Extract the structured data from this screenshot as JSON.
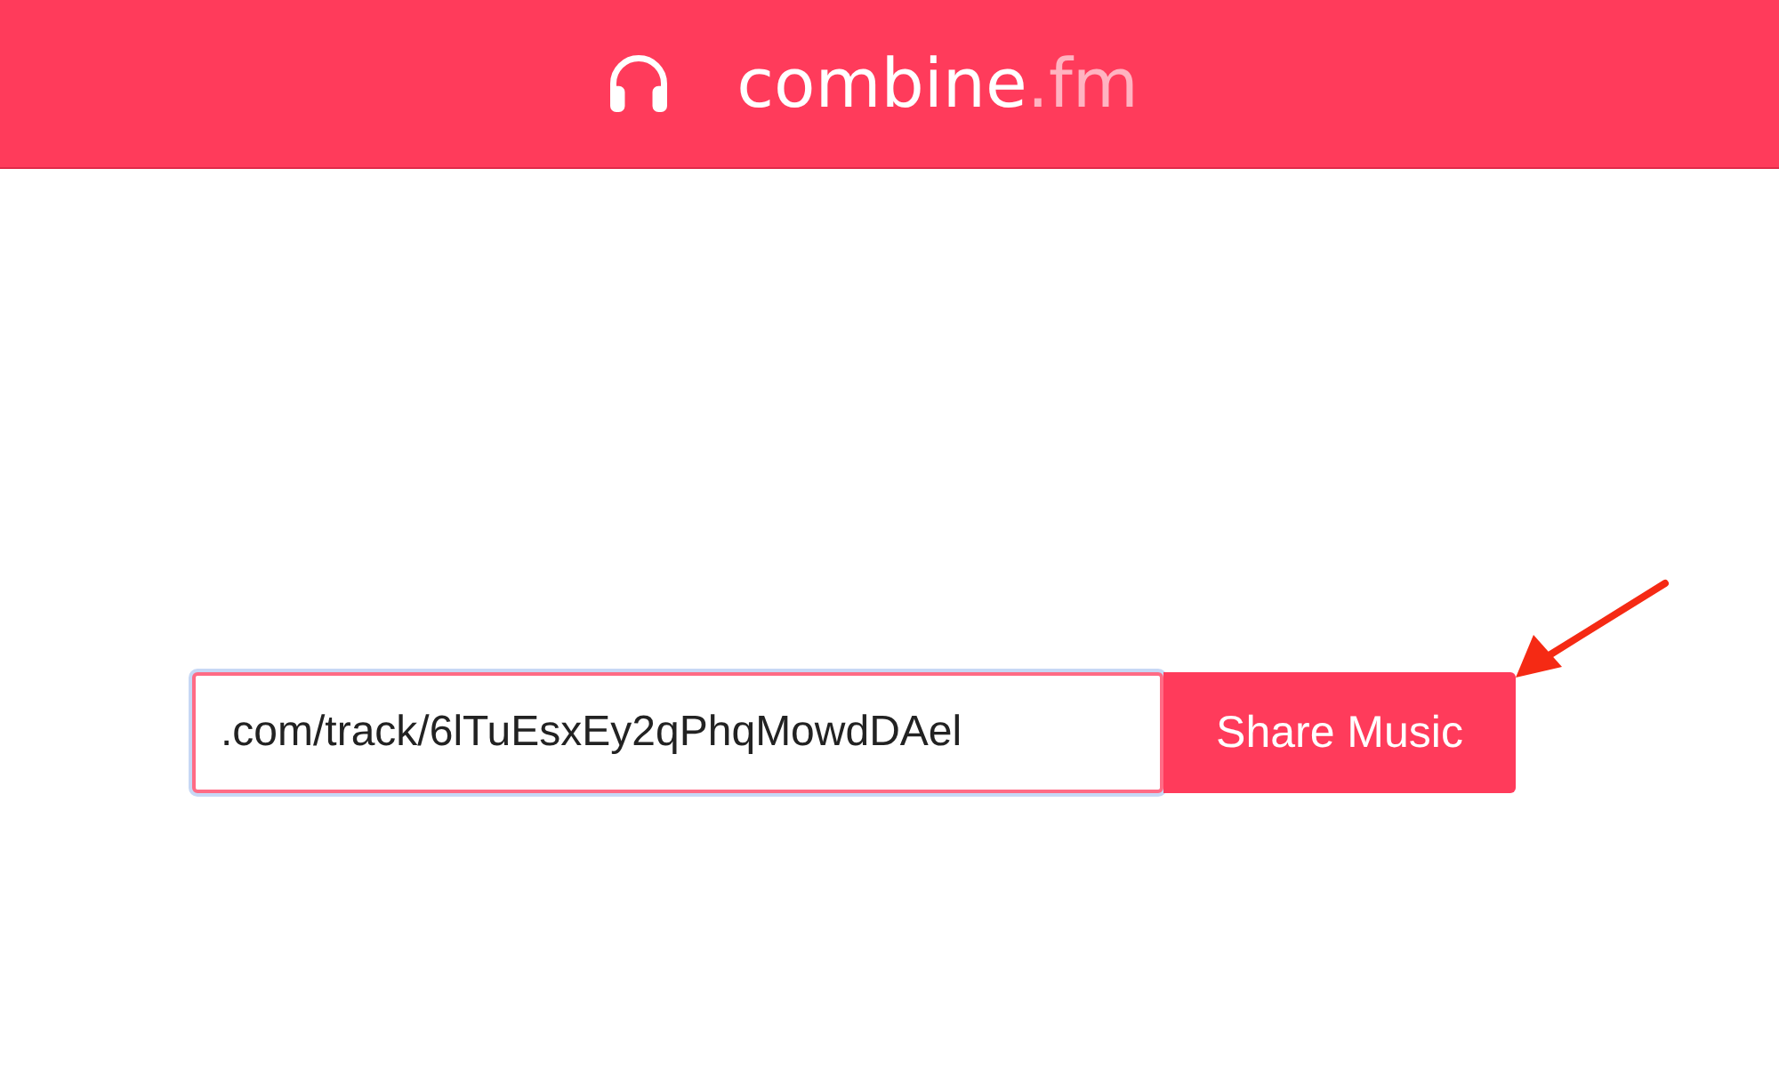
{
  "header": {
    "logo_name": "combine",
    "logo_suffix": ".fm"
  },
  "share_form": {
    "url_value": ".com/track/6lTuEsxEy2qPhqMowdDAel",
    "button": "Share Music"
  }
}
